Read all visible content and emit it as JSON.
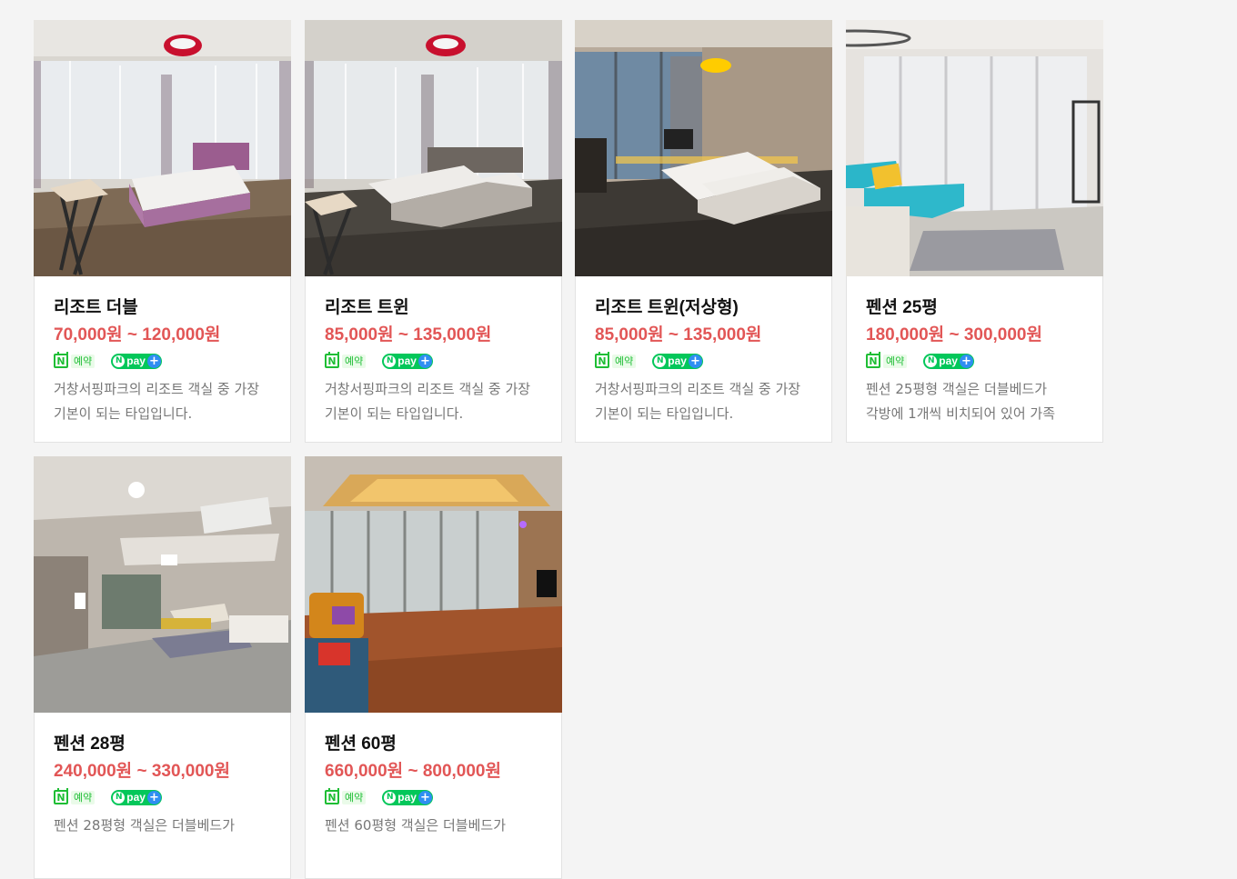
{
  "rooms": [
    {
      "name": "리조트 더블",
      "price": "70,000원 ~ 120,000원",
      "booking_label": "예약",
      "npay_label": "pay",
      "description": "거창서핑파크의 리조트 객실 중 가장 기본이 되는 타입입니다."
    },
    {
      "name": "리조트 트윈",
      "price": "85,000원 ~ 135,000원",
      "booking_label": "예약",
      "npay_label": "pay",
      "description": "거창서핑파크의 리조트 객실 중 가장 기본이 되는 타입입니다."
    },
    {
      "name": "리조트 트윈(저상형)",
      "price": "85,000원 ~ 135,000원",
      "booking_label": "예약",
      "npay_label": "pay",
      "description": "거창서핑파크의 리조트 객실 중 가장 기본이 되는 타입입니다."
    },
    {
      "name": "펜션 25평",
      "price": "180,000원 ~ 300,000원",
      "booking_label": "예약",
      "npay_label": "pay",
      "description": "펜션 25평형 객실은 더블베드가 각방에 1개씩 비치되어 있어 가족"
    },
    {
      "name": "펜션 28평",
      "price": "240,000원 ~ 330,000원",
      "booking_label": "예약",
      "npay_label": "pay",
      "description": "펜션 28평형 객실은 더블베드가"
    },
    {
      "name": "펜션 60평",
      "price": "660,000원 ~ 800,000원",
      "booking_label": "예약",
      "npay_label": "pay",
      "description": "펜션 60평형 객실은 더블베드가"
    }
  ],
  "colors": {
    "price": "#e25656",
    "naver_green": "#03c75a",
    "npay_plus": "#2f8ef2"
  },
  "icons": {
    "booking": "naver-booking-icon",
    "npay": "naver-pay-icon"
  }
}
